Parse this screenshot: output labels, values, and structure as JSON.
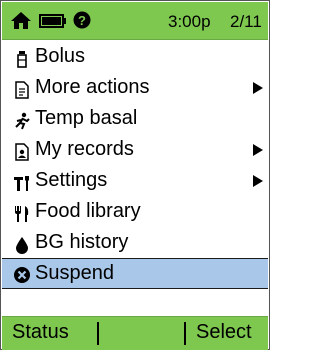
{
  "status_bar": {
    "time": "3:00p",
    "date": "2/11",
    "icons": [
      "home-icon",
      "battery-icon",
      "help-icon"
    ]
  },
  "menu": {
    "items": [
      {
        "label": "Bolus",
        "icon": "vial-icon",
        "submenu": false
      },
      {
        "label": "More actions",
        "icon": "document-icon",
        "submenu": true
      },
      {
        "label": "Temp basal",
        "icon": "running-person-icon",
        "submenu": false
      },
      {
        "label": "My records",
        "icon": "records-icon",
        "submenu": true
      },
      {
        "label": "Settings",
        "icon": "tools-icon",
        "submenu": true
      },
      {
        "label": "Food library",
        "icon": "fork-knife-icon",
        "submenu": false
      },
      {
        "label": "BG history",
        "icon": "blood-drop-icon",
        "submenu": false
      },
      {
        "label": "Suspend",
        "icon": "stop-x-icon",
        "submenu": false,
        "selected": true
      }
    ]
  },
  "softkeys": {
    "left": "Status",
    "right": "Select"
  },
  "colors": {
    "bar_green": "#7ec850",
    "selection_blue": "#a9c7e8"
  }
}
